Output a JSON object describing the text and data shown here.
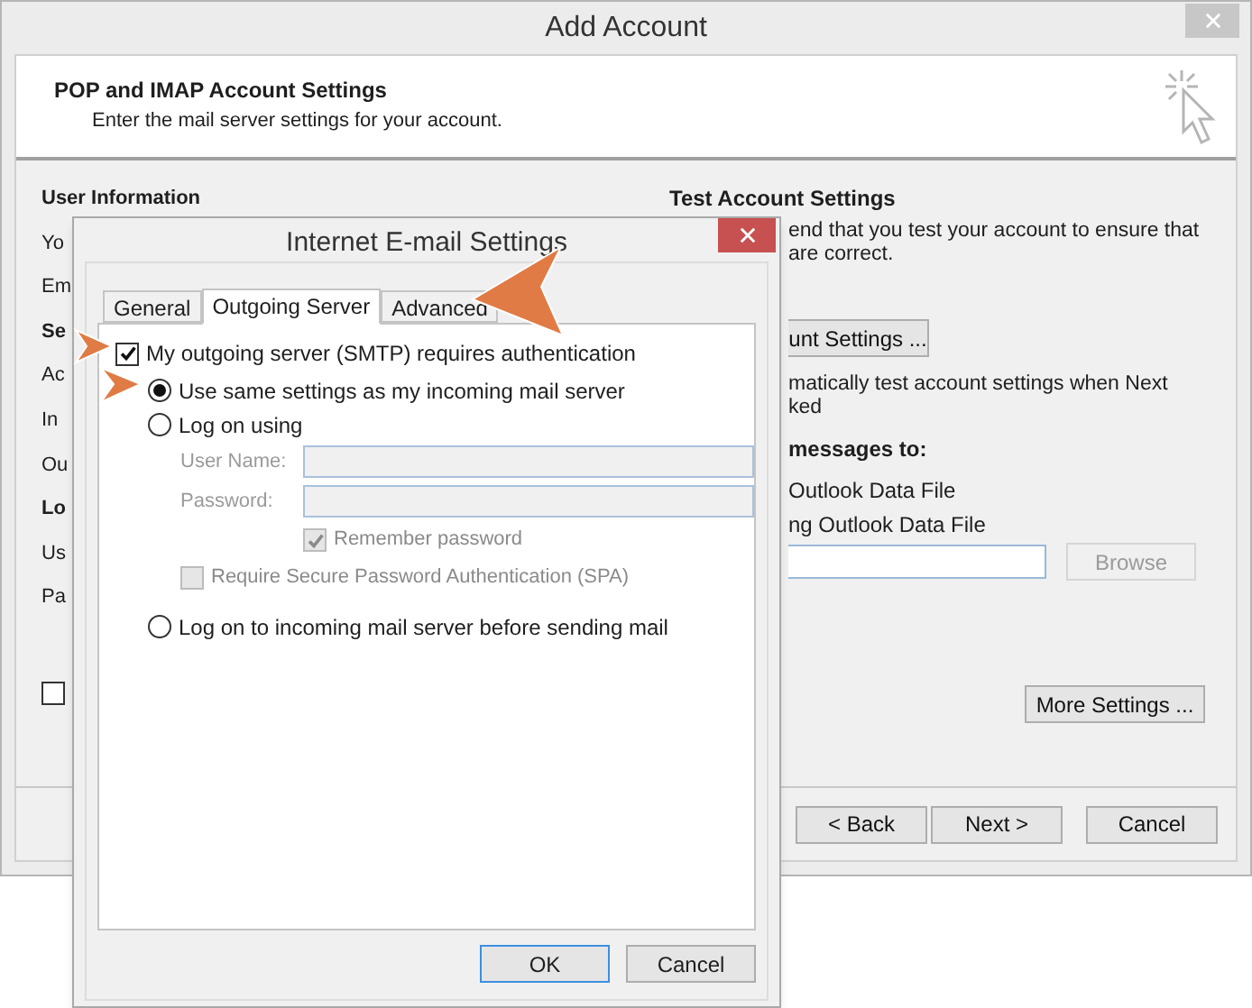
{
  "window": {
    "title": "Add Account"
  },
  "header": {
    "title": "POP and IMAP Account Settings",
    "subtitle": "Enter the mail server settings for your account."
  },
  "left_column": [
    {
      "kind": "heading",
      "text": "User Information"
    },
    {
      "kind": "label",
      "text": "Yo"
    },
    {
      "kind": "label",
      "text": "Em"
    },
    {
      "kind": "heading",
      "text": "Se"
    },
    {
      "kind": "label",
      "text": "Ac"
    },
    {
      "kind": "label",
      "text": "In"
    },
    {
      "kind": "label",
      "text": "Ou"
    },
    {
      "kind": "heading",
      "text": "Lo"
    },
    {
      "kind": "label",
      "text": "Us"
    },
    {
      "kind": "label",
      "text": "Pa"
    }
  ],
  "left_checkbox": {
    "checked": false
  },
  "right_column": {
    "heading": "Test Account Settings",
    "lines": [
      "end that you test your account to ensure that",
      "are correct."
    ],
    "test_button": "unt Settings ...",
    "auto_test_lines": [
      "matically test account settings when Next",
      "ked"
    ],
    "deliver_heading": "messages to:",
    "deliver_options": [
      "Outlook Data File",
      "ng Outlook Data File"
    ],
    "browse_button": {
      "label": "Browse",
      "disabled": true
    },
    "more_settings_button": "More Settings ..."
  },
  "footer_buttons": [
    "< Back",
    "Next >",
    "Cancel"
  ],
  "dialog": {
    "title": "Internet E-mail Settings",
    "tabs": [
      {
        "label": "General",
        "selected": false
      },
      {
        "label": "Outgoing Server",
        "selected": true
      },
      {
        "label": "Advanced",
        "selected": false
      }
    ],
    "auth_checkbox": {
      "label": "My outgoing server (SMTP) requires authentication",
      "checked": true
    },
    "options": [
      {
        "label": "Use same settings as my incoming mail server",
        "selected": true
      },
      {
        "label": "Log on using",
        "selected": false
      }
    ],
    "fields": [
      {
        "label": "User Name:",
        "disabled": true
      },
      {
        "label": "Password:",
        "disabled": true
      }
    ],
    "checkboxes": [
      {
        "label": "Remember password",
        "checked": true,
        "disabled": true
      },
      {
        "label": "Require Secure Password Authentication (SPA)",
        "checked": false,
        "disabled": true
      }
    ],
    "last_option": {
      "label": "Log on to incoming mail server before sending mail",
      "selected": false
    },
    "buttons": [
      "OK",
      "Cancel"
    ]
  }
}
